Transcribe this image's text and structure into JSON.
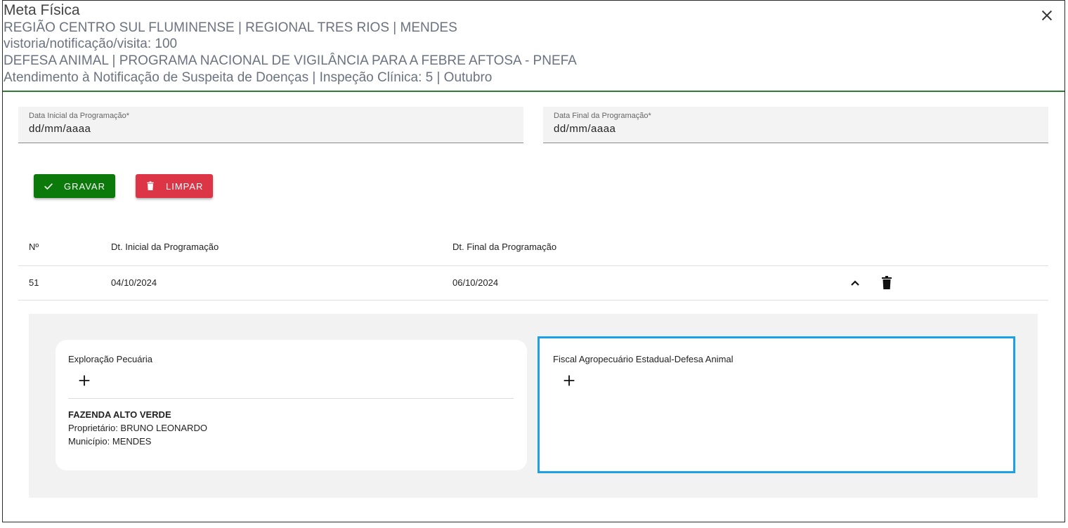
{
  "dialog": {
    "title": "Meta Física",
    "lines": [
      "REGIÃO CENTRO SUL FLUMINENSE | REGIONAL TRES RIOS | MENDES",
      "vistoria/notificação/visita: 100",
      "DEFESA ANIMAL | PROGRAMA NACIONAL DE VIGILÂNCIA PARA A FEBRE AFTOSA - PNEFA",
      "Atendimento à Notificação de Suspeita de Doenças | Inspeção Clínica: 5 | Outubro"
    ],
    "close_icon": "close-icon"
  },
  "form": {
    "start_label": "Data Inicial da Programação*",
    "start_placeholder": "dd/mm/aaaa",
    "end_label": "Data Final da Programação*",
    "end_placeholder": "dd/mm/aaaa"
  },
  "actions": {
    "save_label": "GRAVAR",
    "save_color": "#0b7a0b",
    "clear_label": "LIMPAR",
    "clear_color": "#dc3545"
  },
  "table": {
    "headers": [
      "Nº",
      "Dt. Inicial da Programação",
      "Dt. Final da Programação"
    ],
    "rows": [
      {
        "num": "51",
        "start": "04/10/2024",
        "end": "06/10/2024"
      }
    ]
  },
  "detail": {
    "exploracao": {
      "title": "Exploração Pecuária",
      "farm_name": "FAZENDA ALTO VERDE",
      "owner": "Proprietário: BRUNO LEONARDO",
      "municipality": "Município: MENDES"
    },
    "fiscal": {
      "title": "Fiscal Agropecuário Estadual-Defesa Animal",
      "highlight_color": "#1ea0e6"
    }
  }
}
